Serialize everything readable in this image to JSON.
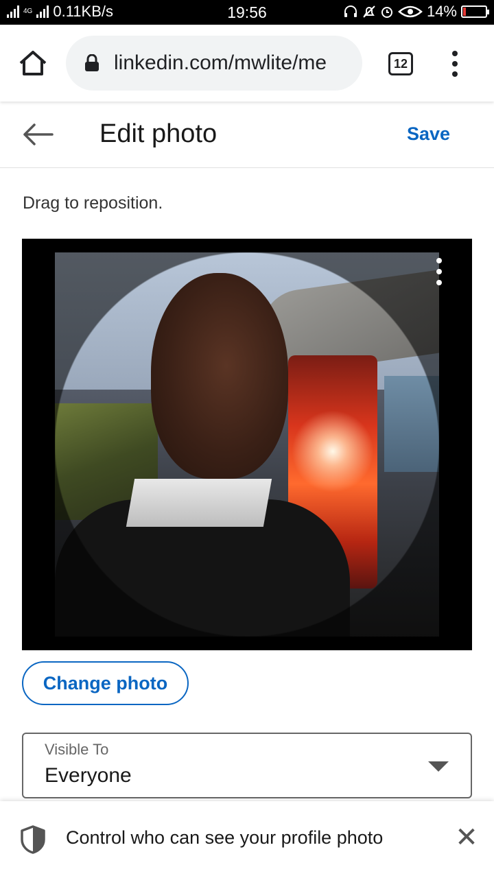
{
  "status_bar": {
    "network_type": "4G",
    "data_speed": "0.11KB/s",
    "time": "19:56",
    "battery": "14%",
    "battery_level": 0.14,
    "icons": [
      "signal-icon",
      "headset-icon",
      "mute-icon",
      "alarm-icon",
      "eye-icon",
      "battery-icon"
    ]
  },
  "browser": {
    "url": "linkedin.com/mwlite/me",
    "tab_count": "12",
    "icons": [
      "home-icon",
      "lock-icon",
      "more-vert-icon"
    ]
  },
  "header": {
    "title": "Edit photo",
    "save_label": "Save"
  },
  "editor": {
    "hint": "Drag to reposition."
  },
  "actions": {
    "change_photo_label": "Change photo"
  },
  "visibility": {
    "label": "Visible To",
    "value": "Everyone"
  },
  "toast": {
    "message": "Control who can see your profile photo"
  },
  "colors": {
    "accent": "#0a66c2",
    "status_bar_bg": "#000000",
    "battery_low": "#e53935"
  }
}
